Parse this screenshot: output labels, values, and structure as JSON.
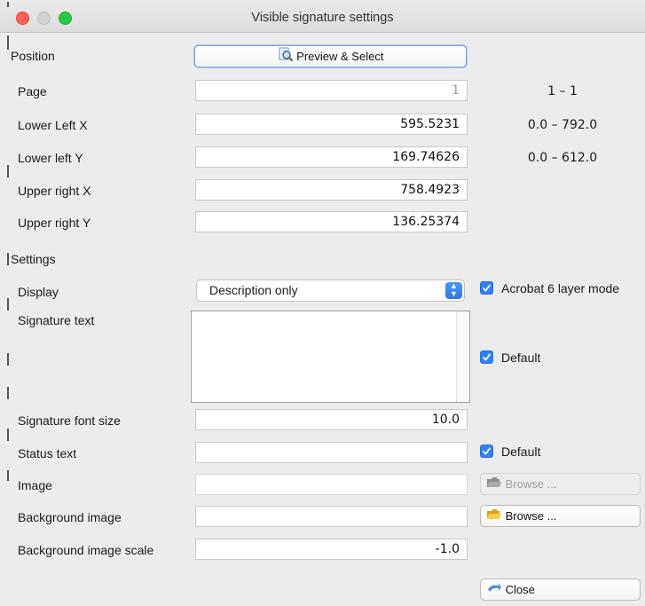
{
  "window": {
    "title": "Visible signature settings"
  },
  "position_section": {
    "label": "Position",
    "preview_button": "Preview & Select"
  },
  "page": {
    "label": "Page",
    "value": "1",
    "range": "1 – 1"
  },
  "lower_left_x": {
    "label": "Lower Left X",
    "value": "595.5231",
    "range": "0.0 – 792.0"
  },
  "lower_left_y": {
    "label": "Lower left Y",
    "value": "169.74626",
    "range": "0.0 – 612.0"
  },
  "upper_right_x": {
    "label": "Upper right X",
    "value": "758.4923"
  },
  "upper_right_y": {
    "label": "Upper right Y",
    "value": "136.25374"
  },
  "settings_section": {
    "label": "Settings"
  },
  "display": {
    "label": "Display",
    "selected": "Description only"
  },
  "acrobat6": {
    "label": "Acrobat 6 layer mode",
    "checked": true
  },
  "signature_text": {
    "label": "Signature text",
    "value": ""
  },
  "signature_text_default": {
    "label": "Default",
    "checked": true
  },
  "signature_font_size": {
    "label": "Signature font size",
    "value": "10.0"
  },
  "status_text": {
    "label": "Status text",
    "value": ""
  },
  "status_text_default": {
    "label": "Default",
    "checked": true
  },
  "image": {
    "label": "Image",
    "value": "",
    "browse_label": "Browse ...",
    "browse_enabled": false
  },
  "background_image": {
    "label": "Background image",
    "value": "",
    "browse_label": "Browse ..."
  },
  "background_image_scale": {
    "label": "Background image scale",
    "value": "-1.0"
  },
  "close_button": {
    "label": "Close"
  },
  "colors": {
    "accent": "#3580ef",
    "close_red": "#fe5f57",
    "zoom_green": "#28c840"
  }
}
